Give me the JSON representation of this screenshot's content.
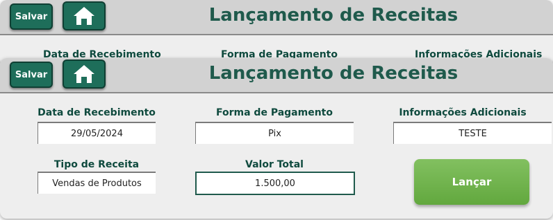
{
  "header": {
    "save_label": "Salvar",
    "home_icon": "home-icon",
    "title": "Lançamento de Receitas"
  },
  "form": {
    "data_recebimento": {
      "label": "Data de Recebimento",
      "value": "29/05/2024"
    },
    "forma_pagamento": {
      "label": "Forma de Pagamento",
      "value": "Pix"
    },
    "info_adicionais": {
      "label": "Informações Adicionais",
      "value": "TESTE"
    },
    "tipo_receita": {
      "label": "Tipo de Receita",
      "value": "Vendas de Produtos"
    },
    "valor_total": {
      "label": "Valor Total",
      "value": "1.500,00"
    }
  },
  "actions": {
    "lancar_label": "Lançar"
  },
  "colors": {
    "accent": "#1e6e5a",
    "title": "#1f5a4c",
    "lancar": "#6fb24b"
  }
}
